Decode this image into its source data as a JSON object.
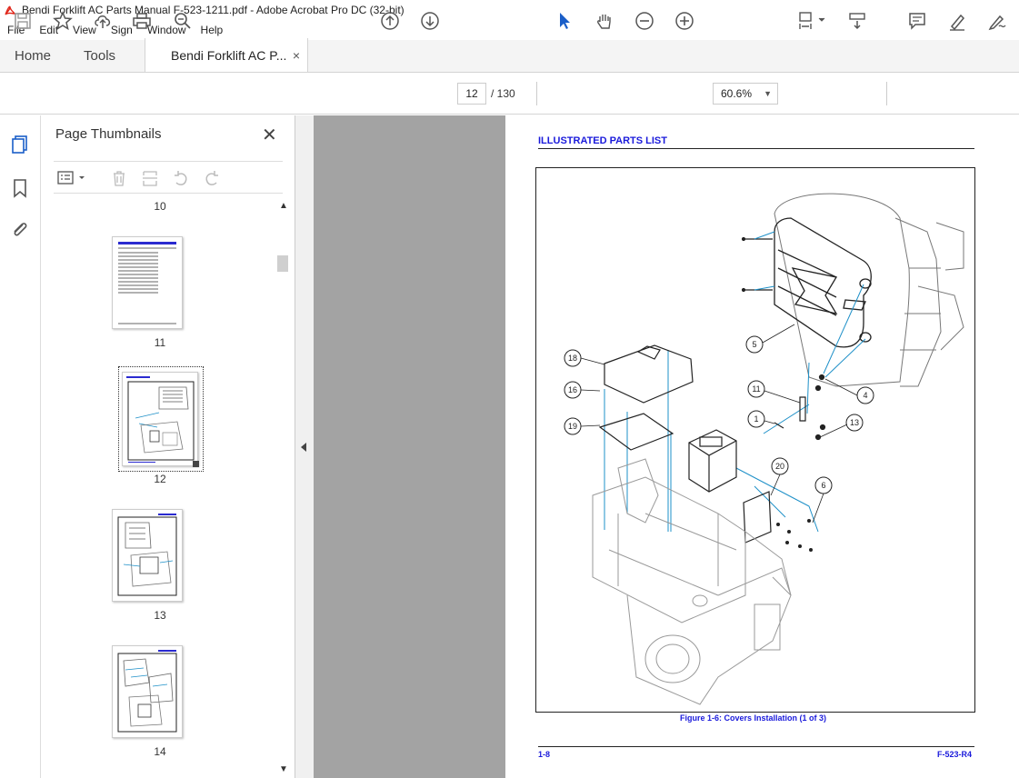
{
  "window": {
    "title": "Bendi Forklift AC Parts Manual F-523-1211.pdf - Adobe Acrobat Pro DC (32-bit)"
  },
  "menu": [
    "File",
    "Edit",
    "View",
    "Sign",
    "Window",
    "Help"
  ],
  "tabs": {
    "home": "Home",
    "tools": "Tools",
    "doc": "Bendi Forklift AC P...",
    "doc_close": "×"
  },
  "toolbar": {
    "page_current": "12",
    "page_total": "/ 130",
    "zoom": "60.6%"
  },
  "panel": {
    "title": "Page Thumbnails",
    "close": "✕",
    "thumbs": [
      "10",
      "11",
      "12",
      "13",
      "14"
    ]
  },
  "page": {
    "header": "ILLUSTRATED PARTS LIST",
    "caption": "Figure 1-6:  Covers Installation (1 of 3)",
    "footer_left": "1-8",
    "footer_right": "F-523-R4",
    "callouts": [
      "18",
      "16",
      "19",
      "5",
      "11",
      "4",
      "1",
      "13",
      "20",
      "6"
    ]
  },
  "colors": {
    "accent_blue": "#1a1adb",
    "leader_blue": "#1e90c8"
  }
}
